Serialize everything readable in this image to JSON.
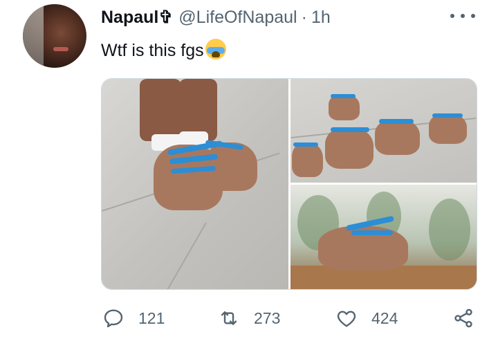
{
  "tweet": {
    "author_name": "Napaul✞",
    "handle": "@LifeOfNapaul",
    "separator": "·",
    "time": "1h",
    "text": "Wtf is this fgs",
    "emoji_name": "loudly-crying-face-emoji"
  },
  "media": {
    "images": [
      {
        "name": "feet-shoes-worn"
      },
      {
        "name": "feet-shoes-group"
      },
      {
        "name": "feet-shoe-closeup"
      }
    ]
  },
  "actions": {
    "replies": "121",
    "retweets": "273",
    "likes": "424"
  },
  "colors": {
    "text": "#0f1419",
    "secondary": "#536471",
    "border": "#cfd9de",
    "lace_blue": "#2b8ed6"
  },
  "icons": [
    "more-icon",
    "reply-icon",
    "retweet-icon",
    "like-icon",
    "share-icon"
  ]
}
